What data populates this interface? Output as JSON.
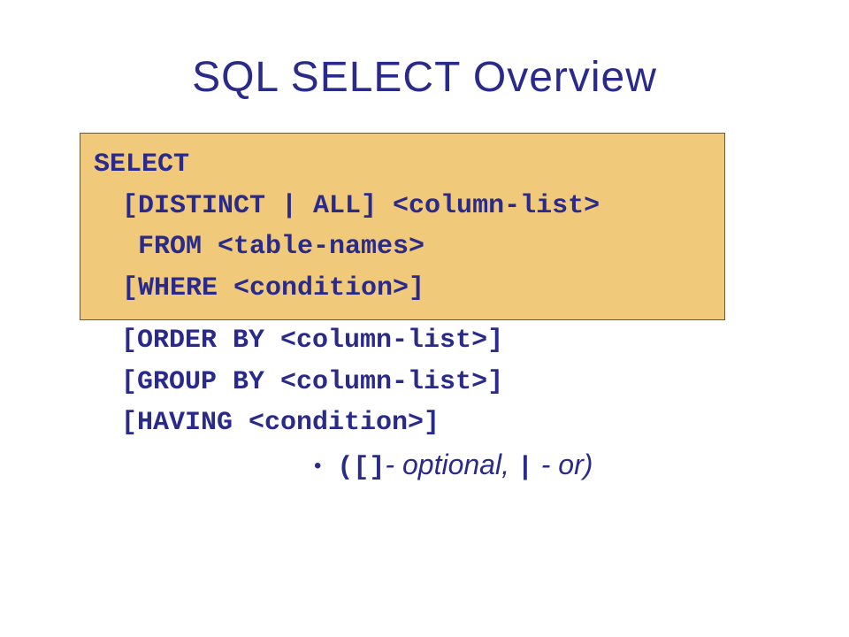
{
  "title": "SQL SELECT Overview",
  "syntax": {
    "lines": [
      "SELECT",
      "[DISTINCT | ALL] <column-list>",
      "FROM <table-names>",
      "[WHERE <condition>]",
      "[ORDER BY <column-list>]",
      "[GROUP BY <column-list>]",
      "[HAVING <condition>]"
    ]
  },
  "legend": {
    "bracket_symbol": "([]",
    "bracket_meaning": "- optional, ",
    "pipe_symbol": "|",
    "pipe_meaning": " - or)"
  }
}
